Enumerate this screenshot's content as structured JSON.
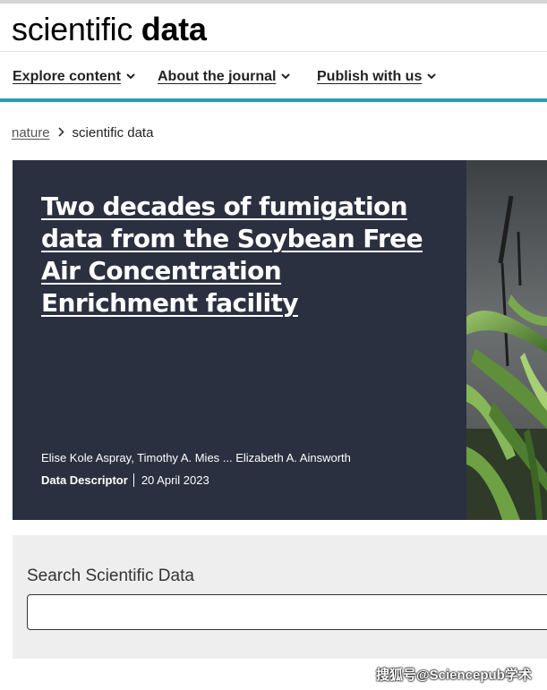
{
  "header": {
    "logo_light": "scientific",
    "logo_bold": "data"
  },
  "nav": {
    "items": [
      {
        "label": "Explore content"
      },
      {
        "label": "About the journal"
      },
      {
        "label": "Publish with us"
      }
    ]
  },
  "breadcrumb": {
    "root": "nature",
    "current": "scientific data"
  },
  "article": {
    "title": "Two decades of fumigation data from the Soybean Free Air Concentration Enrichment facility",
    "authors": "Elise Kole Aspray, Timothy A. Mies ... Elizabeth A. Ainsworth",
    "type": "Data Descriptor",
    "date": "20 April 2023",
    "image": "corn-field-photo"
  },
  "search": {
    "label": "Search Scientific Data",
    "value": "",
    "placeholder": ""
  },
  "watermark": {
    "text": "搜狐号@Sciencepub学术"
  },
  "colors": {
    "accent_rule": "#2a9bb7",
    "hero_background": "#2a3040",
    "search_background": "#eeeeee"
  }
}
